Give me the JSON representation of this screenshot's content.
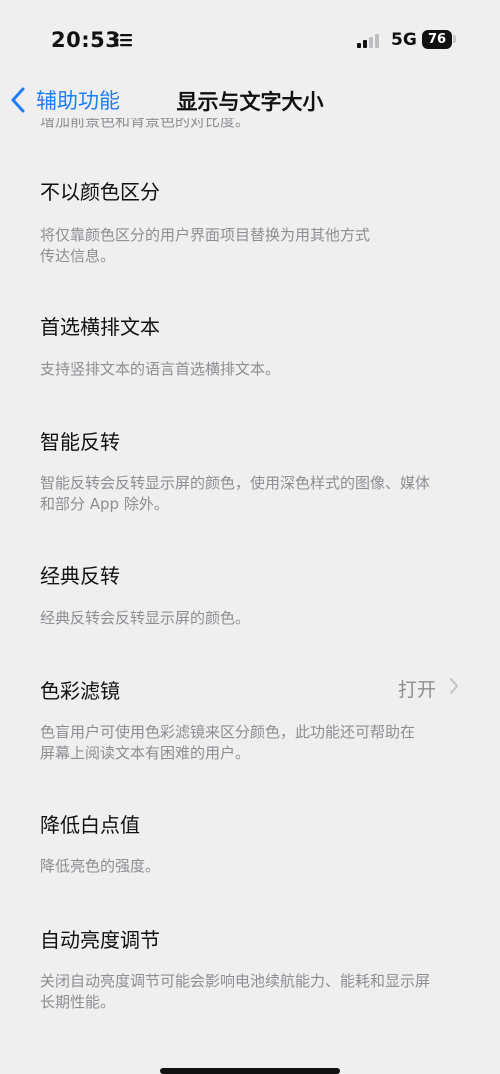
{
  "status_bar": {
    "time": "20:53",
    "network": "5G",
    "battery": "76"
  },
  "nav": {
    "back_label": "辅助功能",
    "title": "显示与文字大小"
  },
  "cut_text": "增加前景色和背景色的对比度。",
  "rows": [
    {
      "title": "不以颜色区分",
      "desc_lines": [
        "将仅靠颜色区分的用户界面项目替换为用其他方式",
        "传达信息。"
      ]
    },
    {
      "title": "首选横排文本",
      "desc_lines": [
        "支持竖排文本的语言首选横排文本。"
      ]
    },
    {
      "title": "智能反转",
      "desc_lines": [
        "智能反转会反转显示屏的颜色，使用深色样式的图像、媒体",
        "和部分 App 除外。"
      ]
    },
    {
      "title": "经典反转",
      "desc_lines": [
        "经典反转会反转显示屏的颜色。"
      ]
    },
    {
      "title": "色彩滤镜",
      "value": "打开",
      "desc_lines": [
        "色盲用户可使用色彩滤镜来区分颜色，此功能还可帮助在",
        "屏幕上阅读文本有困难的用户。"
      ]
    },
    {
      "title": "降低白点值",
      "desc_lines": [
        "降低亮色的强度。"
      ]
    },
    {
      "title": "自动亮度调节",
      "desc_lines": [
        "关闭自动亮度调节可能会影响电池续航能力、能耗和显示屏",
        "长期性能。"
      ]
    }
  ],
  "colors": {
    "accent": "#1e7ef5",
    "background": "#efeff0",
    "secondary_text": "#8e8e93"
  }
}
